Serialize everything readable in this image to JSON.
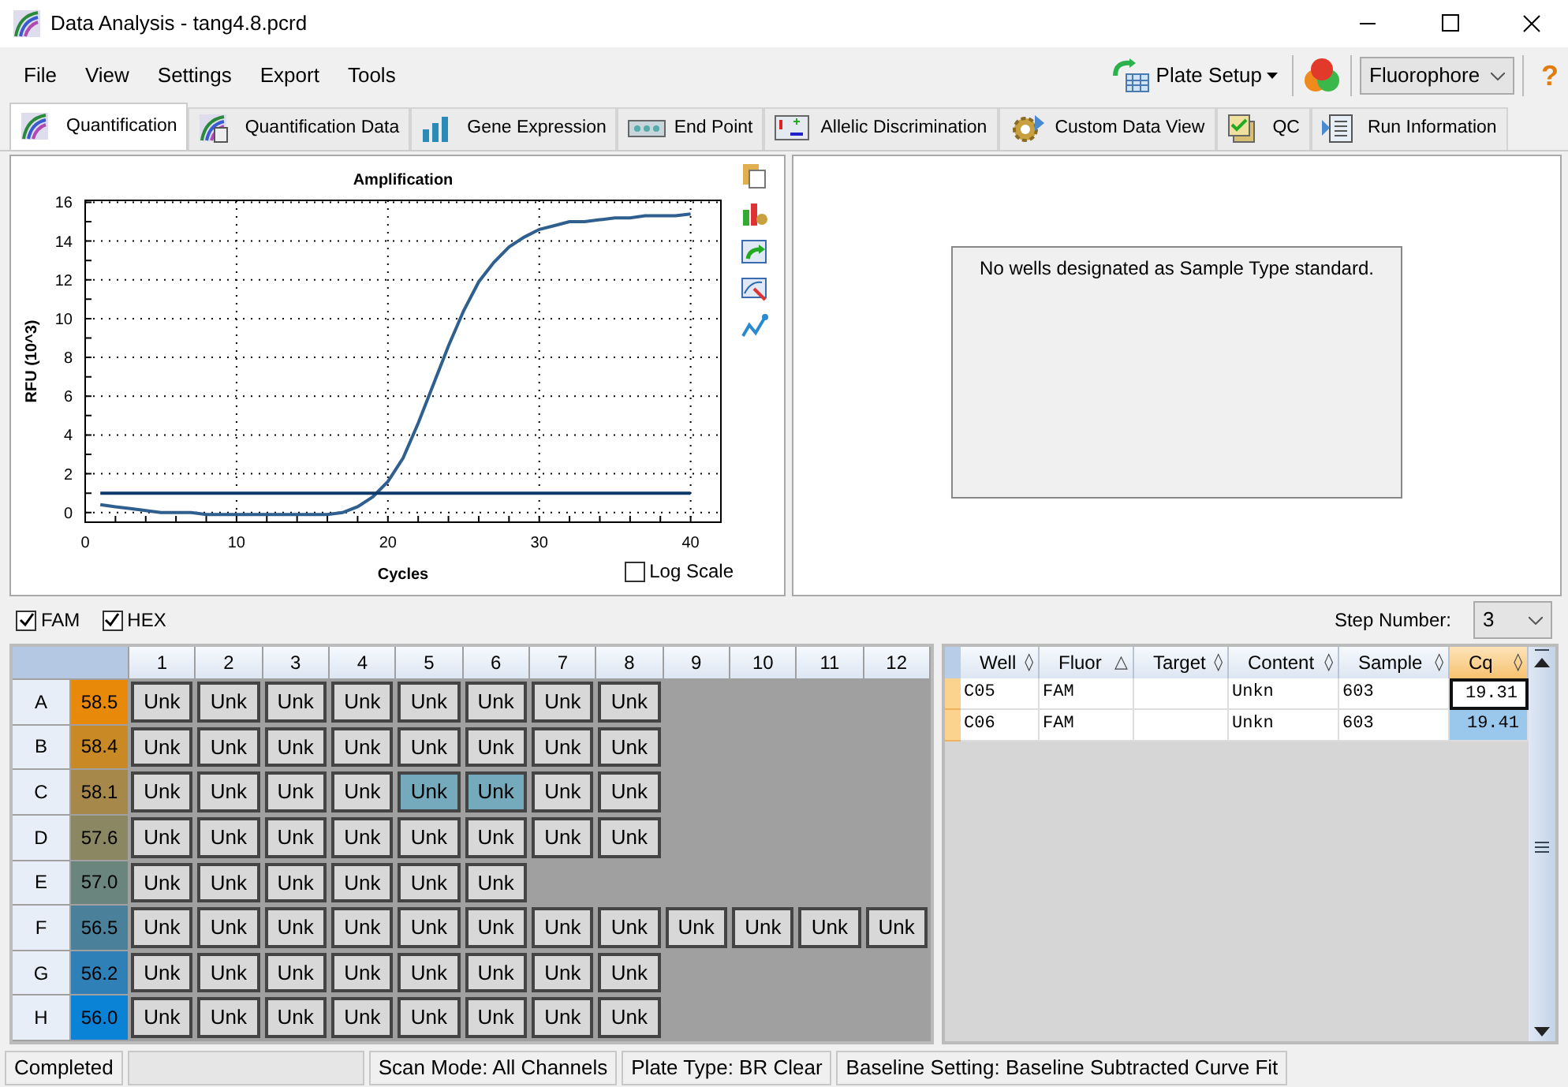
{
  "window": {
    "title": "Data Analysis - tang4.8.pcrd"
  },
  "menu": [
    "File",
    "View",
    "Settings",
    "Export",
    "Tools"
  ],
  "toolbar": {
    "plate_setup": "Plate Setup",
    "fluorophore": "Fluorophore",
    "help": "?"
  },
  "tabs": [
    {
      "label": "Quantification",
      "selected": true
    },
    {
      "label": "Quantification Data",
      "selected": false
    },
    {
      "label": "Gene Expression",
      "selected": false
    },
    {
      "label": "End Point",
      "selected": false
    },
    {
      "label": "Allelic Discrimination",
      "selected": false
    },
    {
      "label": "Custom Data View",
      "selected": false
    },
    {
      "label": "QC",
      "selected": false
    },
    {
      "label": "Run Information",
      "selected": false
    }
  ],
  "amplification": {
    "log_scale": {
      "label": "Log Scale",
      "checked": false
    },
    "chart_data": {
      "type": "line",
      "title": "Amplification",
      "xlabel": "Cycles",
      "ylabel": "RFU (10^3)",
      "x": [
        1,
        2,
        3,
        4,
        5,
        6,
        7,
        8,
        9,
        10,
        11,
        12,
        13,
        14,
        15,
        16,
        17,
        18,
        19,
        20,
        21,
        22,
        23,
        24,
        25,
        26,
        27,
        28,
        29,
        30,
        31,
        32,
        33,
        34,
        35,
        36,
        37,
        38,
        39,
        40
      ],
      "grid": true,
      "series": [
        {
          "color": "#2f5f8f",
          "values": [
            0.4,
            0.3,
            0.2,
            0.1,
            0,
            0,
            0,
            -0.1,
            -0.1,
            -0.1,
            -0.1,
            -0.1,
            -0.1,
            -0.1,
            -0.1,
            -0.1,
            0,
            0.3,
            0.8,
            1.6,
            2.8,
            4.6,
            6.6,
            8.6,
            10.4,
            11.9,
            12.9,
            13.7,
            14.2,
            14.6,
            14.8,
            15,
            15,
            15.1,
            15.2,
            15.2,
            15.3,
            15.3,
            15.3,
            15.4
          ]
        },
        {
          "color": "#0b3a6a",
          "values": [
            1,
            1,
            1,
            1,
            1,
            1,
            1,
            1,
            1,
            1,
            1,
            1,
            1,
            1,
            1,
            1,
            1,
            1,
            1,
            1,
            1,
            1,
            1,
            1,
            1,
            1,
            1,
            1,
            1,
            1,
            1,
            1,
            1,
            1,
            1,
            1,
            1,
            1,
            1,
            1
          ]
        }
      ],
      "xlim": [
        0,
        42
      ],
      "ylim": [
        -0.5,
        16.1
      ],
      "xticks": [
        0,
        10,
        20,
        30,
        40
      ],
      "yticks": [
        0,
        2,
        4,
        6,
        8,
        10,
        12,
        14,
        16
      ]
    }
  },
  "standard_curve": {
    "message": "No wells designated as Sample Type standard."
  },
  "fluorophores": [
    {
      "label": "FAM",
      "checked": true
    },
    {
      "label": "HEX",
      "checked": true
    }
  ],
  "step_number": {
    "label": "Step Number:",
    "value": "3"
  },
  "plate": {
    "columns": [
      "1",
      "2",
      "3",
      "4",
      "5",
      "6",
      "7",
      "8",
      "9",
      "10",
      "11",
      "12"
    ],
    "rows": [
      {
        "label": "A",
        "temperature": "58.5",
        "color": "#e8890a",
        "wells": [
          {
            "text": "Unk",
            "selected": false
          },
          {
            "text": "Unk",
            "selected": false
          },
          {
            "text": "Unk",
            "selected": false
          },
          {
            "text": "Unk",
            "selected": false
          },
          {
            "text": "Unk",
            "selected": false
          },
          {
            "text": "Unk",
            "selected": false
          },
          {
            "text": "Unk",
            "selected": false
          },
          {
            "text": "Unk",
            "selected": false
          },
          {
            "kind": "empty"
          },
          {
            "kind": "empty"
          },
          {
            "kind": "empty"
          },
          {
            "kind": "empty"
          }
        ]
      },
      {
        "label": "B",
        "temperature": "58.4",
        "color": "#c98a25",
        "wells": [
          {
            "text": "Unk",
            "selected": false
          },
          {
            "text": "Unk",
            "selected": false
          },
          {
            "text": "Unk",
            "selected": false
          },
          {
            "text": "Unk",
            "selected": false
          },
          {
            "text": "Unk",
            "selected": false
          },
          {
            "text": "Unk",
            "selected": false
          },
          {
            "text": "Unk",
            "selected": false
          },
          {
            "text": "Unk",
            "selected": false
          },
          {
            "kind": "empty"
          },
          {
            "kind": "empty"
          },
          {
            "kind": "empty"
          },
          {
            "kind": "empty"
          }
        ]
      },
      {
        "label": "C",
        "temperature": "58.1",
        "color": "#a6884a",
        "wells": [
          {
            "text": "Unk",
            "selected": false
          },
          {
            "text": "Unk",
            "selected": false
          },
          {
            "text": "Unk",
            "selected": false
          },
          {
            "text": "Unk",
            "selected": false
          },
          {
            "text": "Unk",
            "selected": true
          },
          {
            "text": "Unk",
            "selected": true
          },
          {
            "text": "Unk",
            "selected": false
          },
          {
            "text": "Unk",
            "selected": false
          },
          {
            "kind": "empty"
          },
          {
            "kind": "empty"
          },
          {
            "kind": "empty"
          },
          {
            "kind": "empty"
          }
        ]
      },
      {
        "label": "D",
        "temperature": "57.6",
        "color": "#8b8762",
        "wells": [
          {
            "text": "Unk",
            "selected": false
          },
          {
            "text": "Unk",
            "selected": false
          },
          {
            "text": "Unk",
            "selected": false
          },
          {
            "text": "Unk",
            "selected": false
          },
          {
            "text": "Unk",
            "selected": false
          },
          {
            "text": "Unk",
            "selected": false
          },
          {
            "text": "Unk",
            "selected": false
          },
          {
            "text": "Unk",
            "selected": false
          },
          {
            "kind": "empty"
          },
          {
            "kind": "empty"
          },
          {
            "kind": "empty"
          },
          {
            "kind": "empty"
          }
        ]
      },
      {
        "label": "E",
        "temperature": "57.0",
        "color": "#6a857e",
        "wells": [
          {
            "text": "Unk",
            "selected": false
          },
          {
            "text": "Unk",
            "selected": false
          },
          {
            "text": "Unk",
            "selected": false
          },
          {
            "text": "Unk",
            "selected": false
          },
          {
            "text": "Unk",
            "selected": false
          },
          {
            "text": "Unk",
            "selected": false
          },
          {
            "kind": "empty"
          },
          {
            "kind": "empty"
          },
          {
            "kind": "empty"
          },
          {
            "kind": "empty"
          },
          {
            "kind": "empty"
          },
          {
            "kind": "empty"
          }
        ]
      },
      {
        "label": "F",
        "temperature": "56.5",
        "color": "#4a8099",
        "wells": [
          {
            "text": "Unk",
            "selected": false
          },
          {
            "text": "Unk",
            "selected": false
          },
          {
            "text": "Unk",
            "selected": false
          },
          {
            "text": "Unk",
            "selected": false
          },
          {
            "text": "Unk",
            "selected": false
          },
          {
            "text": "Unk",
            "selected": false
          },
          {
            "text": "Unk",
            "selected": false
          },
          {
            "text": "Unk",
            "selected": false
          },
          {
            "text": "Unk",
            "selected": false
          },
          {
            "text": "Unk",
            "selected": false
          },
          {
            "text": "Unk",
            "selected": false
          },
          {
            "text": "Unk",
            "selected": false
          }
        ]
      },
      {
        "label": "G",
        "temperature": "56.2",
        "color": "#2e80b6",
        "wells": [
          {
            "text": "Unk",
            "selected": false
          },
          {
            "text": "Unk",
            "selected": false
          },
          {
            "text": "Unk",
            "selected": false
          },
          {
            "text": "Unk",
            "selected": false
          },
          {
            "text": "Unk",
            "selected": false
          },
          {
            "text": "Unk",
            "selected": false
          },
          {
            "text": "Unk",
            "selected": false
          },
          {
            "text": "Unk",
            "selected": false
          },
          {
            "kind": "empty"
          },
          {
            "kind": "empty"
          },
          {
            "kind": "empty"
          },
          {
            "kind": "empty"
          }
        ]
      },
      {
        "label": "H",
        "temperature": "56.0",
        "color": "#0a82d6",
        "wells": [
          {
            "text": "Unk",
            "selected": false
          },
          {
            "text": "Unk",
            "selected": false
          },
          {
            "text": "Unk",
            "selected": false
          },
          {
            "text": "Unk",
            "selected": false
          },
          {
            "text": "Unk",
            "selected": false
          },
          {
            "text": "Unk",
            "selected": false
          },
          {
            "text": "Unk",
            "selected": false
          },
          {
            "text": "Unk",
            "selected": false
          },
          {
            "kind": "empty"
          },
          {
            "kind": "empty"
          },
          {
            "kind": "empty"
          },
          {
            "kind": "empty"
          }
        ]
      }
    ]
  },
  "results": {
    "columns": [
      {
        "label": "Well",
        "sort_mark": "◊",
        "highlighted": false
      },
      {
        "label": "Fluor",
        "sort_mark": "△",
        "highlighted": false
      },
      {
        "label": "Target",
        "sort_mark": "◊",
        "highlighted": false
      },
      {
        "label": "Content",
        "sort_mark": "◊",
        "highlighted": false
      },
      {
        "label": "Sample",
        "sort_mark": "◊",
        "highlighted": false
      },
      {
        "label": "Cq",
        "sort_mark": "◊",
        "highlighted": true
      }
    ],
    "rows": [
      {
        "cells": [
          "C05",
          "FAM",
          "",
          "Unkn",
          "603",
          "19.31"
        ],
        "focused": true,
        "selected": false
      },
      {
        "cells": [
          "C06",
          "FAM",
          "",
          "Unkn",
          "603",
          "19.41"
        ],
        "focused": false,
        "selected": true
      }
    ]
  },
  "status_bar": [
    "Completed",
    "Scan Mode: All Channels",
    "Plate Type: BR Clear",
    "Baseline Setting: Baseline Subtracted Curve Fit"
  ]
}
